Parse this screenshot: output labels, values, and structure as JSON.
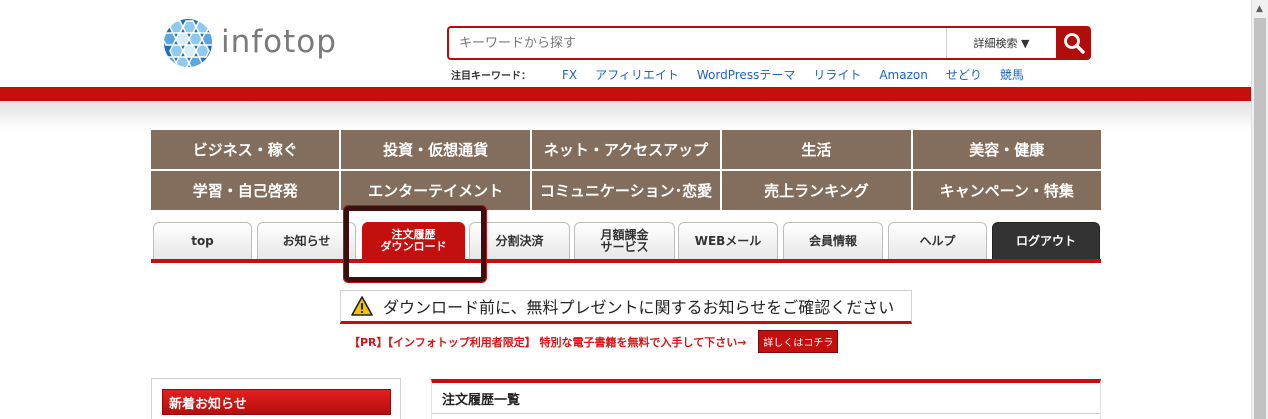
{
  "logo": {
    "text": "infotop"
  },
  "search": {
    "placeholder": "キーワードから探す",
    "advanced_label": "詳細検索 ▼"
  },
  "keywords": {
    "label": "注目キーワード：",
    "items": [
      "FX",
      "アフィリエイト",
      "WordPressテーマ",
      "リライト",
      "Amazon",
      "せどり",
      "競馬"
    ]
  },
  "categories": [
    "ビジネス・稼ぐ",
    "投資・仮想通貨",
    "ネット・アクセスアップ",
    "生活",
    "美容・健康",
    "学習・自己啓発",
    "エンターテイメント",
    "コミュニケーション･恋愛",
    "売上ランキング",
    "キャンペーン・特集"
  ],
  "tabs": {
    "top": "top",
    "news": "お知らせ",
    "order_download_line1": "注文履歴",
    "order_download_line2": "ダウンロード",
    "installment": "分割決済",
    "monthly_line1": "月額課金",
    "monthly_line2": "サービス",
    "webmail": "WEBメール",
    "member": "会員情報",
    "help": "ヘルプ",
    "logout": "ログアウト"
  },
  "notice": {
    "text": "ダウンロード前に、無料プレゼントに関するお知らせをご確認ください"
  },
  "pr": {
    "text": "【PR】【インフォトップ利用者限定】 特別な電子書籍を無料で入手して下さい→",
    "button": "詳しくはコチラ"
  },
  "sidebar": {
    "news_title": "新着お知らせ"
  },
  "main": {
    "orders_title": "注文履歴一覧"
  },
  "colors": {
    "brand_red": "#c40f0f",
    "category_brown": "#836e5d",
    "link_blue": "#1a63c9"
  }
}
